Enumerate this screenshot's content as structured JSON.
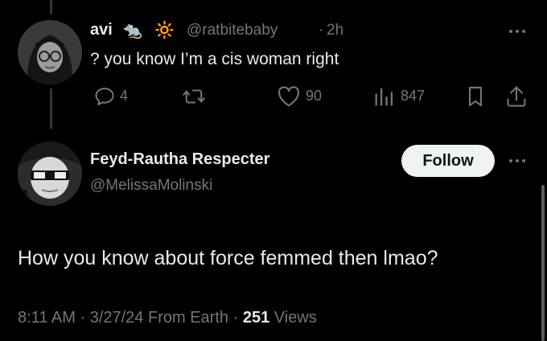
{
  "reply_tweet": {
    "display_name": "avi",
    "emoji_1": "🐀",
    "emoji_2": "🔆",
    "handle": "@ratbitebaby",
    "separator": "·",
    "time_ago": "2h",
    "text": "? you know I’m a cis woman right",
    "actions": {
      "reply_count": "4",
      "retweet_count": "",
      "like_count": "90",
      "view_count": "847"
    }
  },
  "main_tweet": {
    "display_name": "Feyd-Rautha Respecter",
    "handle": "@MelissaMolinski",
    "follow_label": "Follow",
    "text": "How you know about force femmed then lmao?",
    "meta": {
      "time": "8:11 AM",
      "sep1": "·",
      "date": "3/27/24",
      "source": "From Earth",
      "sep2": "·",
      "views_count": "251",
      "views_label": "Views"
    }
  },
  "colors": {
    "background": "#000000",
    "text": "#e7e9ea",
    "muted": "#71767b",
    "button_bg": "#eff3f4"
  }
}
